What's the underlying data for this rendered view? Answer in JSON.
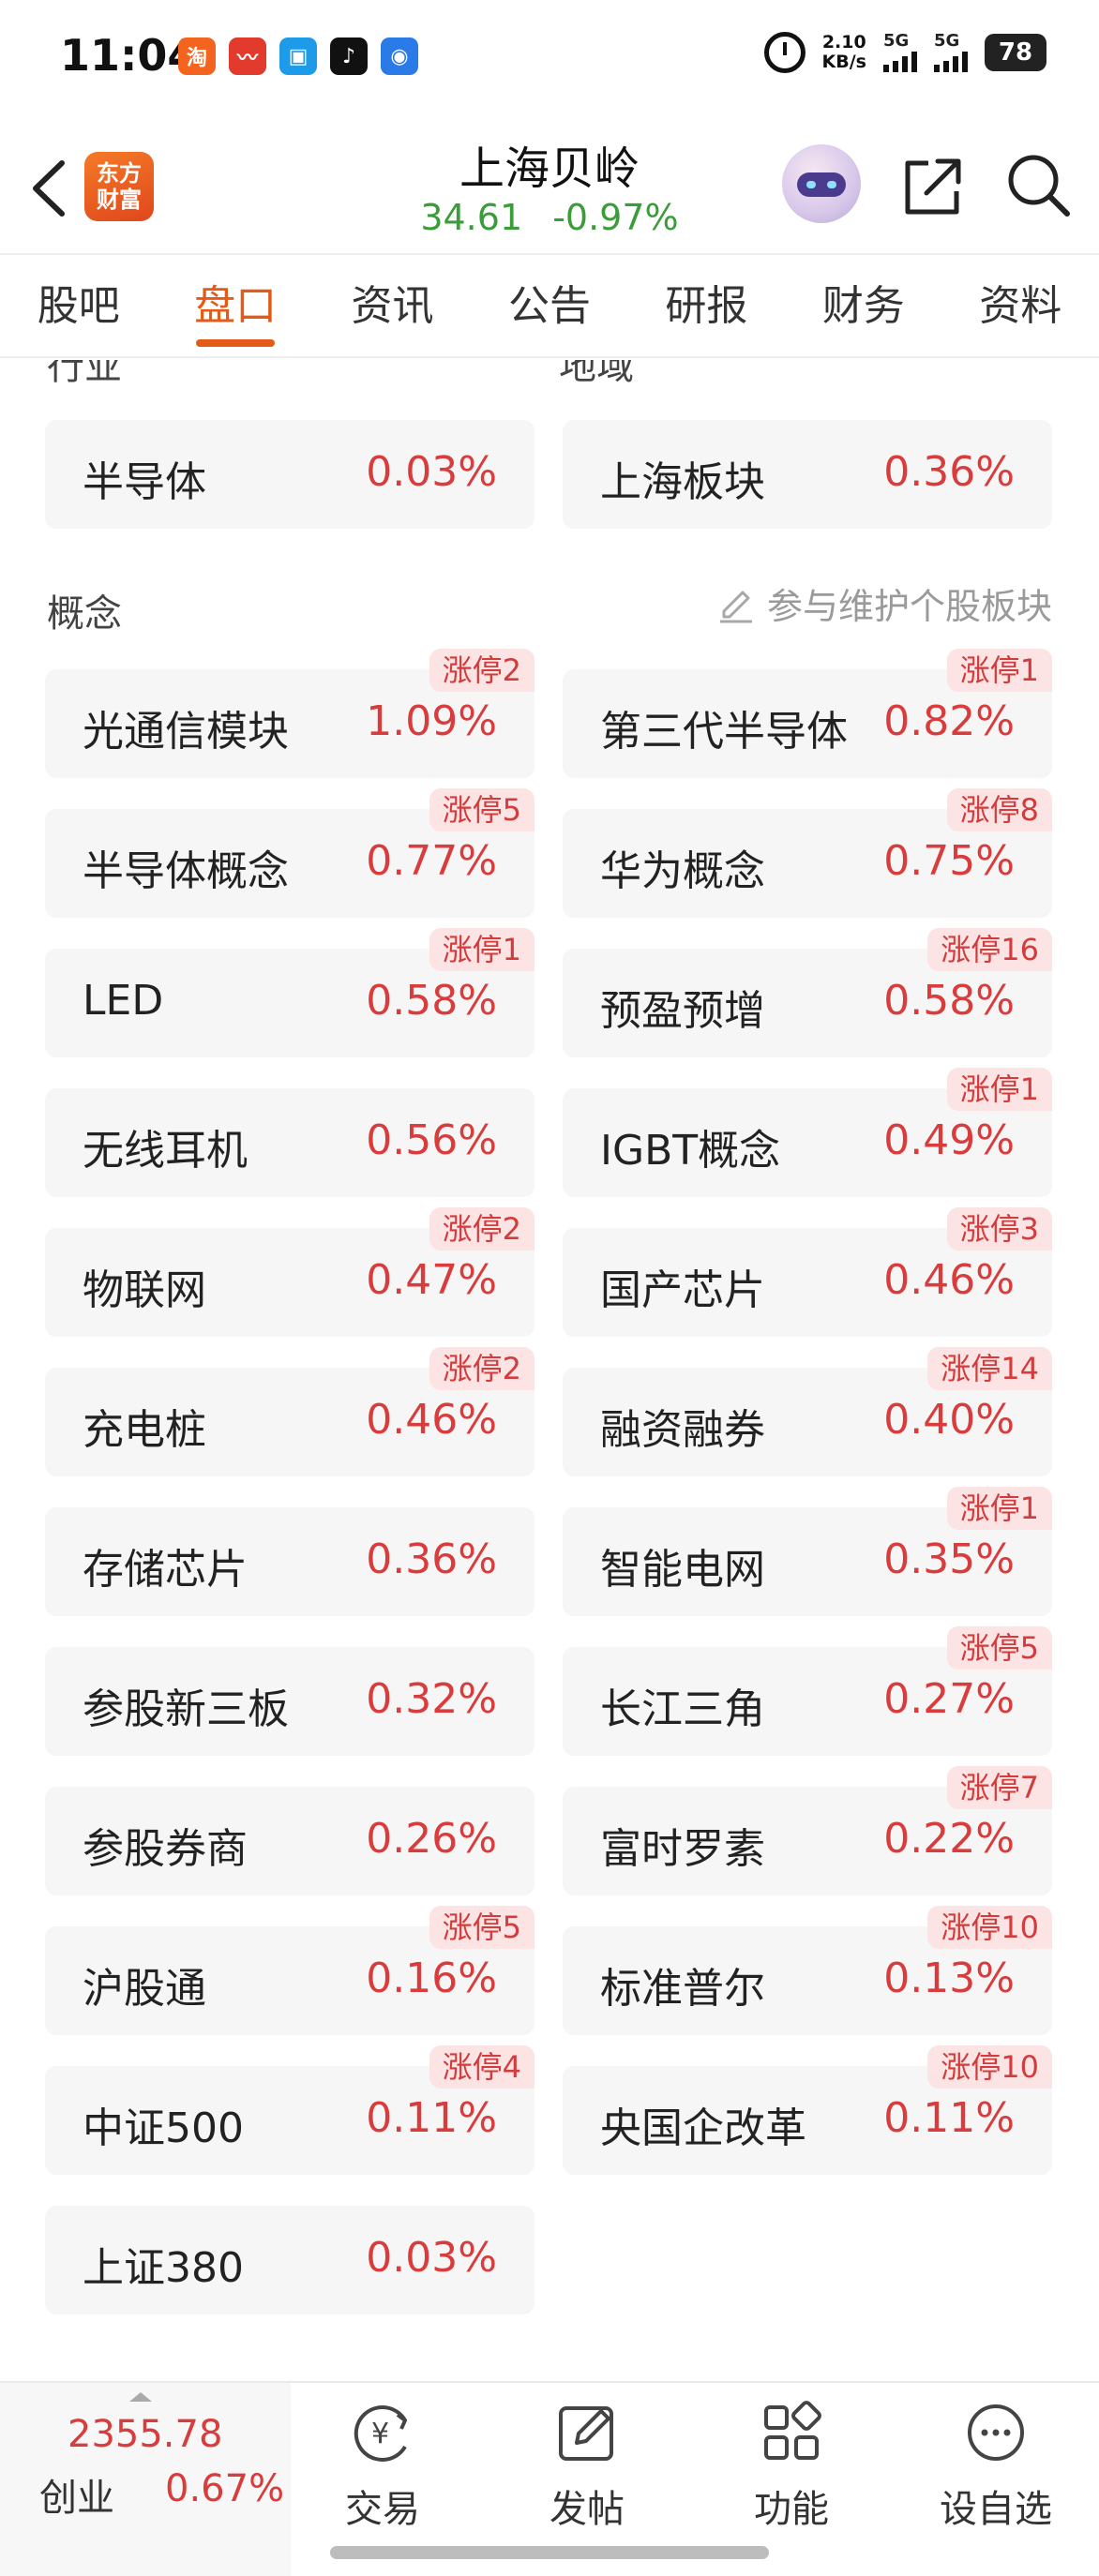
{
  "status_bar": {
    "time": "11:04",
    "net_speed_value": "2.10",
    "net_speed_unit": "KB/s",
    "signal1": "5G",
    "signal2": "5G",
    "battery": "78",
    "app_icons": [
      {
        "name": "taobao-icon",
        "glyph": "淘",
        "color": "#f5641e"
      },
      {
        "name": "stock-app-icon",
        "glyph": "〰",
        "color": "#e23b2e"
      },
      {
        "name": "messaging-icon",
        "glyph": "▣",
        "color": "#1e9be8"
      },
      {
        "name": "tiktok-icon",
        "glyph": "♪",
        "color": "#111111"
      },
      {
        "name": "broadcast-icon",
        "glyph": "◉",
        "color": "#2a7be8"
      }
    ]
  },
  "header": {
    "logo_line1": "东方",
    "logo_line2": "财富",
    "stock_name": "上海贝岭",
    "price": "34.61",
    "change": "-0.97%"
  },
  "tabs": [
    {
      "label": "股吧",
      "active": false
    },
    {
      "label": "盘口",
      "active": true
    },
    {
      "label": "资讯",
      "active": false
    },
    {
      "label": "公告",
      "active": false
    },
    {
      "label": "研报",
      "active": false
    },
    {
      "label": "财务",
      "active": false
    },
    {
      "label": "资料",
      "active": false
    }
  ],
  "sections": {
    "industry_label": "行业",
    "region_label": "地域",
    "concept_label": "概念",
    "maintain_link": "参与维护个股板块"
  },
  "industry_card": {
    "name": "半导体",
    "pct": "0.03%"
  },
  "region_card": {
    "name": "上海板块",
    "pct": "0.36%"
  },
  "concepts": [
    {
      "name": "光通信模块",
      "pct": "1.09%",
      "badge": "涨停2"
    },
    {
      "name": "第三代半导体",
      "pct": "0.82%",
      "badge": "涨停1"
    },
    {
      "name": "半导体概念",
      "pct": "0.77%",
      "badge": "涨停5"
    },
    {
      "name": "华为概念",
      "pct": "0.75%",
      "badge": "涨停8"
    },
    {
      "name": "LED",
      "pct": "0.58%",
      "badge": "涨停1"
    },
    {
      "name": "预盈预增",
      "pct": "0.58%",
      "badge": "涨停16"
    },
    {
      "name": "无线耳机",
      "pct": "0.56%",
      "badge": ""
    },
    {
      "name": "IGBT概念",
      "pct": "0.49%",
      "badge": "涨停1"
    },
    {
      "name": "物联网",
      "pct": "0.47%",
      "badge": "涨停2"
    },
    {
      "name": "国产芯片",
      "pct": "0.46%",
      "badge": "涨停3"
    },
    {
      "name": "充电桩",
      "pct": "0.46%",
      "badge": "涨停2"
    },
    {
      "name": "融资融券",
      "pct": "0.40%",
      "badge": "涨停14"
    },
    {
      "name": "存储芯片",
      "pct": "0.36%",
      "badge": ""
    },
    {
      "name": "智能电网",
      "pct": "0.35%",
      "badge": "涨停1"
    },
    {
      "name": "参股新三板",
      "pct": "0.32%",
      "badge": ""
    },
    {
      "name": "长江三角",
      "pct": "0.27%",
      "badge": "涨停5"
    },
    {
      "name": "参股券商",
      "pct": "0.26%",
      "badge": ""
    },
    {
      "name": "富时罗素",
      "pct": "0.22%",
      "badge": "涨停7"
    },
    {
      "name": "沪股通",
      "pct": "0.16%",
      "badge": "涨停5"
    },
    {
      "name": "标准普尔",
      "pct": "0.13%",
      "badge": "涨停10"
    },
    {
      "name": "中证500",
      "pct": "0.11%",
      "badge": "涨停4"
    },
    {
      "name": "央国企改革",
      "pct": "0.11%",
      "badge": "涨停10"
    },
    {
      "name": "上证380",
      "pct": "0.03%",
      "badge": ""
    }
  ],
  "bottom_bar": {
    "index_value": "2355.78",
    "index_name": "创业",
    "index_pct": "0.67%",
    "nav": [
      {
        "label": "交易",
        "icon": "trade-icon"
      },
      {
        "label": "发帖",
        "icon": "post-icon"
      },
      {
        "label": "功能",
        "icon": "grid-icon"
      },
      {
        "label": "设自选",
        "icon": "more-icon"
      }
    ]
  }
}
